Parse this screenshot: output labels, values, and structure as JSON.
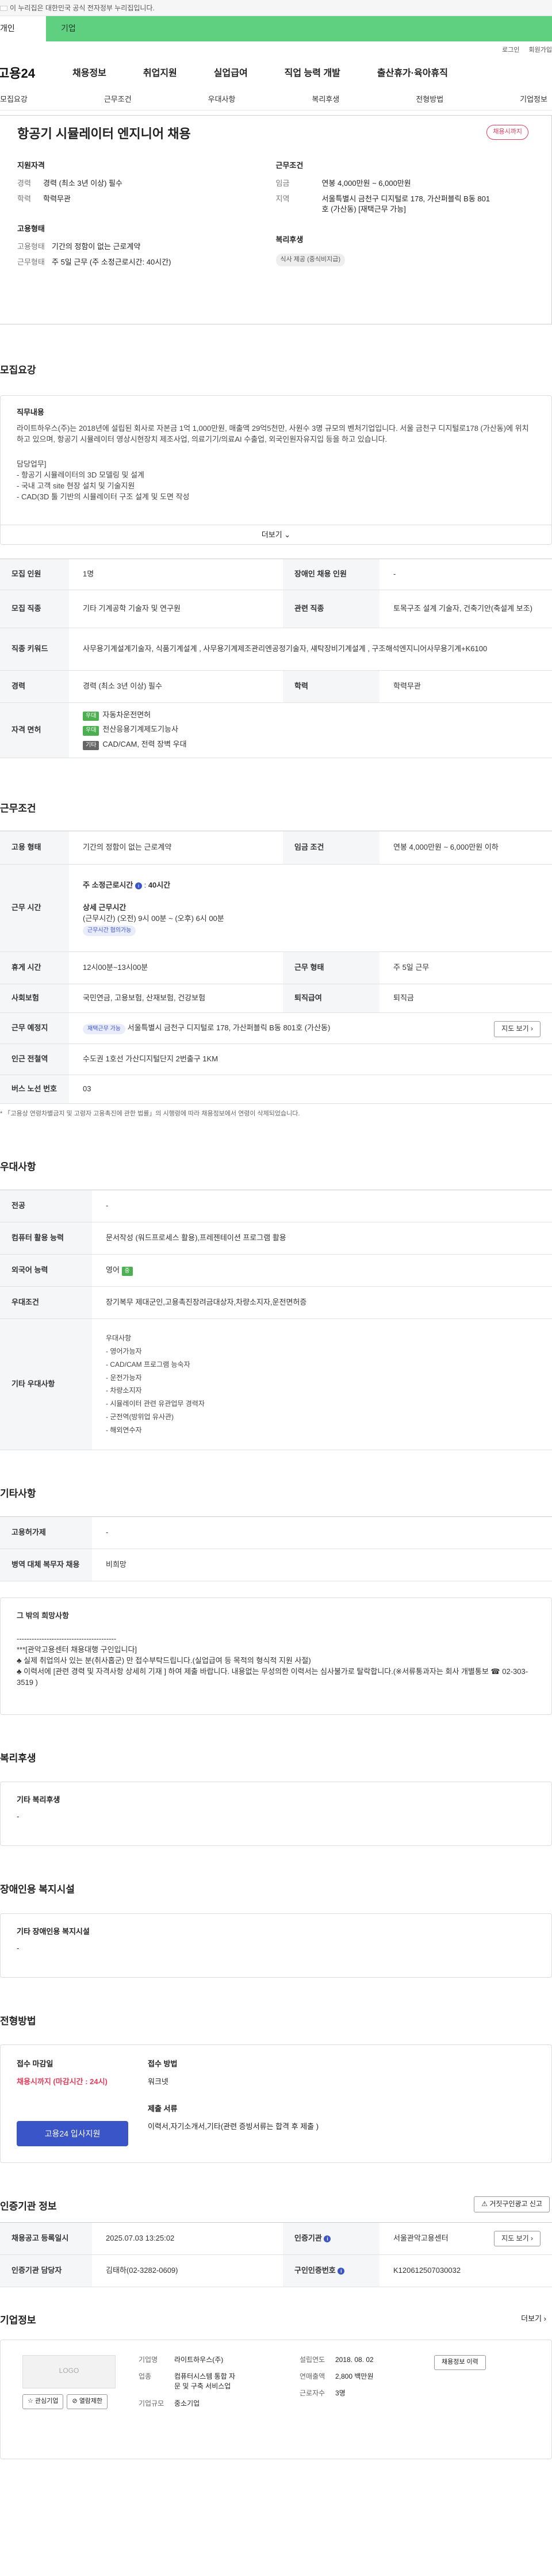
{
  "topbar": {
    "text": "이 누리집은 대한민국 공식 전자정부 누리집입니다."
  },
  "tabs": {
    "t1": "개인",
    "t2": "기업"
  },
  "util": {
    "login": "로그인",
    "join": "회원가입"
  },
  "gnb": {
    "logo": "고용24",
    "items": [
      "채용정보",
      "취업지원",
      "실업급여",
      "직업 능력 개발",
      "출산휴가·육아휴직"
    ]
  },
  "lnb": [
    "모집요강",
    "근무조건",
    "우대사항",
    "복리후생",
    "전형방법",
    "기업정보"
  ],
  "hero": {
    "title": "항공기 시뮬레이터 엔지니어 채용",
    "status": "채용시까지",
    "apply": {
      "heading": "지원자격",
      "career_k": "경력",
      "career_v": "경력 (최소 3년 이상) 필수",
      "edu_k": "학력",
      "edu_v": "학력무관"
    },
    "cond": {
      "heading": "근무조건",
      "wage_k": "임금",
      "wage_v": "연봉 4,000만원 ~ 6,000만원",
      "loc_k": "지역",
      "loc_v": "서울특별시 금천구 디지털로 178, 가산퍼블릭 B동 801호 (가산동) [재택근무 가능]"
    },
    "emp": {
      "heading": "고용형태",
      "type_k": "고용형태",
      "type_v": "기간의 정함이 없는 근로계약",
      "days_k": "근무형태",
      "days_v": "주 5일 근무 (주 소정근로시간: 40시간)"
    },
    "welfare": {
      "heading": "복리후생",
      "chip": "식사 제공 (중식비지급)"
    }
  },
  "recruit": {
    "title": "모집요강",
    "duty_h": "직무내용",
    "duty_p": "라이트하우스(주)는 2018년에 설립된 회사로 자본금 1억 1,000만원, 매출액 29억5천만, 사원수 3명 규모의 벤처기업입니다. 서울 금천구 디지털로178 (가산동)에 위치하고 있으며, 항공기 시뮬레이터 영상시현장치 제조사업, 의료기기/의료AI 수출업, 외국인원자유지입 등을 하고 있습니다.",
    "duty_list": [
      "담당업무]",
      "- 항공기 시뮬레이터의 3D 모델링 및 설계",
      "- 국내 고객 site 현장 설치 및 기술지원",
      "- CAD(3D 툴 기반의 시뮬레이터 구조 설계 및 도면 작성"
    ],
    "more": "더보기",
    "rows": [
      {
        "k": "모집 인원",
        "v": "1명",
        "k2": "장애인 채용 인원",
        "v2": "-"
      },
      {
        "k": "모집 직종",
        "v": "기타 기계공학 기술자 및 연구원",
        "k2": "관련 직종",
        "v2": "토목구조 설계 기술자, 건축기안(축설계 보조)"
      },
      {
        "k": "직종 키워드",
        "v": "사무용기계설계기술자, 식품기계설계 , 사무용기계제조관리엔공정기술자, 섀탁장비기계설계 , 구조해석엔지니어사무용기계+K6100"
      },
      {
        "k": "경력",
        "v": "경력 (최소 3년 이상) 필수",
        "k2": "학력",
        "v2": "학력무관"
      }
    ],
    "license_k": "자격 면허",
    "licenses": [
      {
        "tag": "우대",
        "name": "자동차운전면허"
      },
      {
        "tag": "우대",
        "name": "전산응용기계제도기능사"
      },
      {
        "tag": "기타",
        "name": "CAD/CAM, 전력 장벽 우대"
      }
    ]
  },
  "work": {
    "title": "근무조건",
    "type_k": "고용 형태",
    "type_v": "기간의 정함이 없는 근로계약",
    "wage_k": "임금 조건",
    "wage_v": "연봉 4,000만원 ~ 6,000만원 이하",
    "time_k": "근무 시간",
    "time_week": "주 소정근로시간",
    "time_hours": "40시간",
    "time_detail_h": "상세 근무시간",
    "time_detail": "(근무시간) (오전) 9시 00분 ~ (오후) 6시 00분",
    "time_chip": "근무시간 협의가능",
    "break_k": "휴게 시간",
    "break_v": "12시00분~13시00분",
    "shift_k": "근무 형태",
    "shift_v": "주 5일 근무",
    "ins_k": "사회보험",
    "ins_v": "국민연금, 고용보험, 산재보험, 건강보험",
    "ret_k": "퇴직급여",
    "ret_v": "퇴직금",
    "place_k": "근무 예정지",
    "place_chip": "재택근무 가능",
    "place_v": "서울특별시 금천구 디지털로 178, 가산퍼블릭 B동 801호 (가산동)",
    "map": "지도 보기",
    "sub_k": "인근 전철역",
    "sub_v": "수도권 1호선 가산디지털단지 2번출구 1KM",
    "bus_k": "버스 노선 번호",
    "bus_v": "03",
    "note": "「고용상 연령차별금지 및 고령자 고용촉진에 관한 법률」의 시행령에 따라 채용정보에서 연령이 삭제되었습니다."
  },
  "pref": {
    "title": "우대사항",
    "rows": [
      {
        "k": "전공",
        "v": "-"
      },
      {
        "k": "컴퓨터 활용 능력",
        "v": "문서작성 (워드프로세스 활용),프레젠테이션 프로그램 활용"
      },
      {
        "k": "외국어 능력",
        "v": "영어",
        "chip": "중"
      },
      {
        "k": "우대조건",
        "v": "장기복무 제대군인,고용촉진장려금대상자,차량소지자,운전면허증"
      }
    ],
    "etc_k": "기타 우대사항",
    "etc_list": [
      "우대사항",
      "- 영어가능자",
      "- CAD/CAM 프로그램 능숙자",
      "- 운전가능자",
      "- 차량소지자",
      "- 시뮬레이터 관련 유관업무 경력자",
      "- 군전역(방위업 유사관)",
      "- 해외연수자"
    ]
  },
  "other": {
    "title": "기타사항",
    "rows": [
      {
        "k": "고용허가제",
        "v": "-"
      },
      {
        "k": "병역 대체 복무자 채용",
        "v": "비희망"
      }
    ],
    "hope_h": "그 밖의 희망사항",
    "hope_line": "----------------------------------------",
    "hope": [
      "***[관악고용센터 채용대행 구인입니다]",
      "♣ 실제 취업의사 있는 분(취사홉군) 만 접수부탁드립니다.(실업급여 등 목적의 형식적 지원 사절)",
      "♣ 이력서에 [관련 경력 및 자격사항 상세히 기재 ] 하여 제출 바랍니다. 내용없는 무성의한 이력서는 심사불가로 탈락합니다.(※서류통과자는 회사 개별통보 ☎ 02-303-3519 )"
    ]
  },
  "welfare": {
    "title": "복리후생",
    "h": "기타 복리후생",
    "v": "-"
  },
  "disab": {
    "title": "장애인용 복지시설",
    "h": "기타 장애인용 복지시설",
    "v": "-"
  },
  "proc": {
    "title": "전형방법",
    "dl_h": "접수 마감일",
    "dl_v": "채용시까지 (마감시간 : 24시)",
    "meth_h": "접수 방법",
    "meth_v": "워크넷",
    "btn": "고용24 입사지원",
    "docs_h": "제출 서류",
    "docs_v": "이력서,자기소개서,기타(관련 증빙서류는 합격 후 제출 )"
  },
  "cert": {
    "title": "인증기관 정보",
    "report": "거짓구인광고 신고",
    "reg_k": "채용공고 등록일시",
    "reg_v": "2025.07.03 13:25:02",
    "org_k": "인증기관",
    "org_v": "서울관악고용센터",
    "map": "지도 보기",
    "mgr_k": "인증기관 담당자",
    "mgr_v": "김태하(02-3282-0609)",
    "id_k": "구인인증번호",
    "id_v": "K120612507030032"
  },
  "company": {
    "title": "기업정보",
    "more": "더보기",
    "logo": "LOGO",
    "fav": "관심기업",
    "block": "열람제한",
    "name_k": "기업명",
    "name_v": "라이트하우스(주)",
    "year_k": "설립연도",
    "year_v": "2018. 08. 02",
    "ind_k": "업종",
    "ind_v": "컴퓨터시스템 통합 자문 및 구축 서비스업",
    "rev_k": "연매출액",
    "rev_v": "2,800 백만원",
    "emp_k": "근로자수",
    "emp_v": "3명",
    "scale_k": "기업규모",
    "scale_v": "중소기업",
    "jobs": "채용정보 이력"
  }
}
